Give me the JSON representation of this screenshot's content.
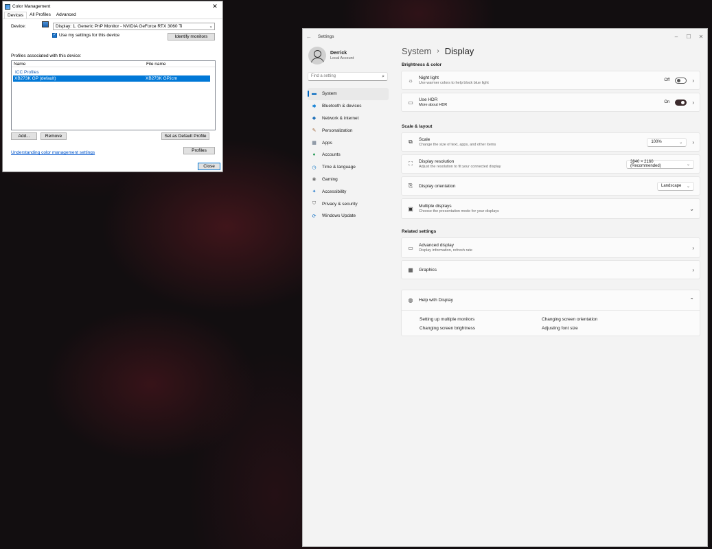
{
  "color_management": {
    "title": "Color Management",
    "tabs": [
      "Devices",
      "All Profiles",
      "Advanced"
    ],
    "device_label": "Device:",
    "device_value": "Display: 1. Generic PnP Monitor - NVIDIA GeForce RTX 3060 Ti",
    "use_my_settings": "Use my settings for this device",
    "identify_button": "Identify monitors",
    "profiles_label": "Profiles associated with this device:",
    "columns": [
      "Name",
      "File name"
    ],
    "group": "ICC Profiles",
    "selected_profile": {
      "name": "XB273K GP (default)",
      "file": "XB273K GP.icm"
    },
    "add_button": "Add...",
    "remove_button": "Remove",
    "default_button": "Set as Default Profile",
    "link": "Understanding color management settings",
    "profiles_button": "Profiles",
    "close_button": "Close"
  },
  "settings": {
    "app_title": "Settings",
    "user": {
      "name": "Derrick",
      "account": "Local Account"
    },
    "search_placeholder": "Find a setting",
    "nav": [
      {
        "label": "System",
        "icon": "monitor-icon",
        "color": "#0067c0",
        "active": true
      },
      {
        "label": "Bluetooth & devices",
        "icon": "bluetooth-icon",
        "color": "#0078d4",
        "active": false
      },
      {
        "label": "Network & internet",
        "icon": "wifi-icon",
        "color": "#1d6fb8",
        "active": false
      },
      {
        "label": "Personalization",
        "icon": "brush-icon",
        "color": "#a36b3f",
        "active": false
      },
      {
        "label": "Apps",
        "icon": "apps-icon",
        "color": "#5a6a7e",
        "active": false
      },
      {
        "label": "Accounts",
        "icon": "person-icon",
        "color": "#2f9e5e",
        "active": false
      },
      {
        "label": "Time & language",
        "icon": "globe-clock-icon",
        "color": "#1a7bc8",
        "active": false
      },
      {
        "label": "Gaming",
        "icon": "gamepad-icon",
        "color": "#777777",
        "active": false
      },
      {
        "label": "Accessibility",
        "icon": "accessibility-icon",
        "color": "#1a73c9",
        "active": false
      },
      {
        "label": "Privacy & security",
        "icon": "shield-icon",
        "color": "#6b6b6b",
        "active": false
      },
      {
        "label": "Windows Update",
        "icon": "update-icon",
        "color": "#0067c0",
        "active": false
      }
    ],
    "breadcrumb": {
      "parent": "System",
      "current": "Display"
    },
    "sections": {
      "brightness": "Brightness & color",
      "scale_layout": "Scale & layout",
      "related": "Related settings"
    },
    "night_light": {
      "title": "Night light",
      "sub": "Use warmer colors to help block blue light",
      "state": "Off"
    },
    "hdr": {
      "title": "Use HDR",
      "sub": "More about HDR",
      "state": "On"
    },
    "scale": {
      "title": "Scale",
      "sub": "Change the size of text, apps, and other items",
      "value": "100%"
    },
    "resolution": {
      "title": "Display resolution",
      "sub": "Adjust the resolution to fit your connected display",
      "value": "3840 × 2160 (Recommended)"
    },
    "orientation": {
      "title": "Display orientation",
      "value": "Landscape"
    },
    "multiple": {
      "title": "Multiple displays",
      "sub": "Choose the presentation mode for your displays"
    },
    "advanced": {
      "title": "Advanced display",
      "sub": "Display information, refresh rate"
    },
    "graphics": {
      "title": "Graphics"
    },
    "help": {
      "title": "Help with Display",
      "links": [
        "Setting up multiple monitors",
        "Changing screen orientation",
        "Changing screen brightness",
        "Adjusting font size"
      ]
    }
  }
}
